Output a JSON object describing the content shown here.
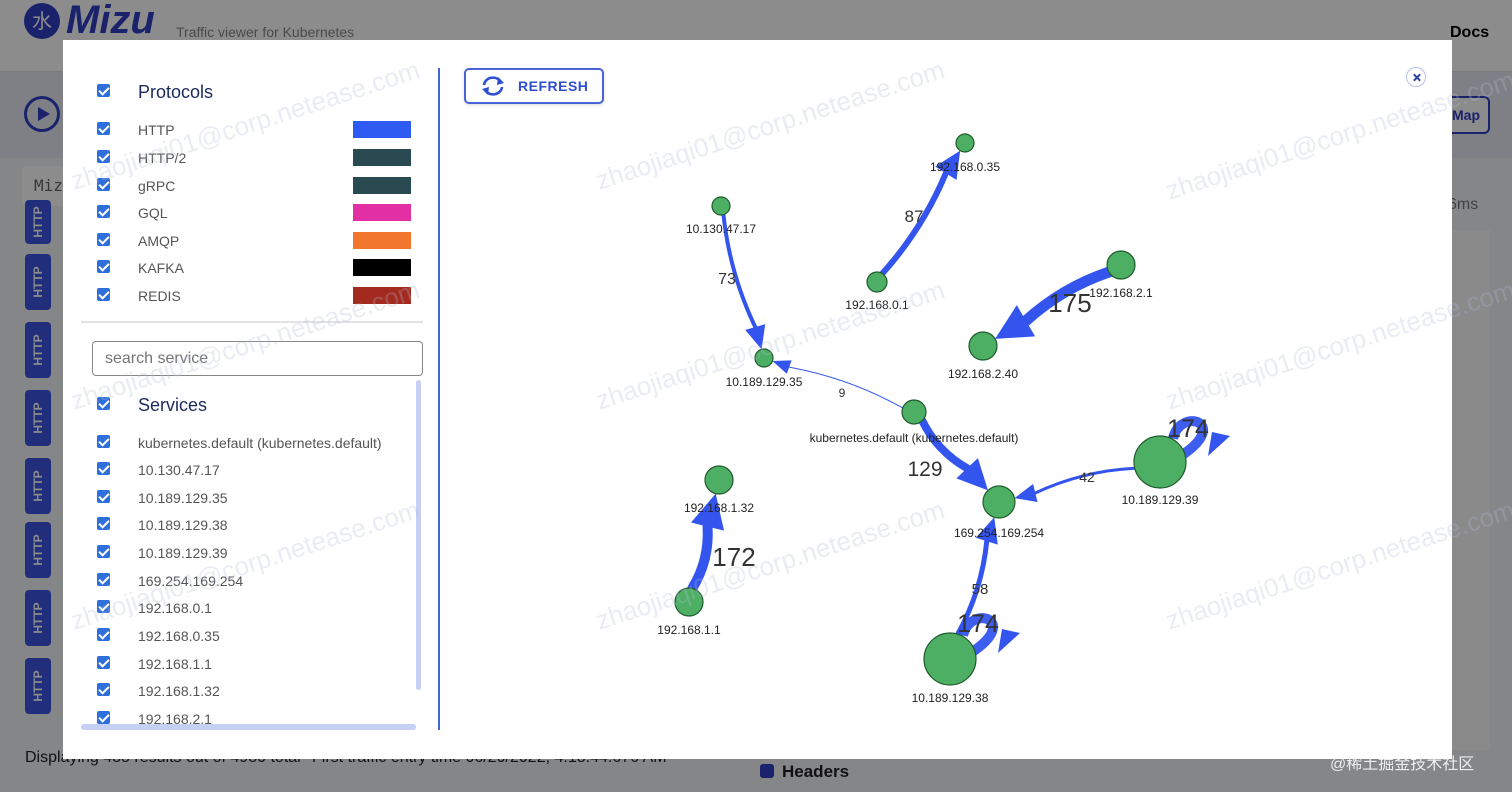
{
  "background": {
    "logo_glyph": "水",
    "logo_text": "Mizu",
    "tagline": "Traffic viewer for Kubernetes",
    "docs_link": "Docs",
    "map_button": "Map",
    "search_prefix": "Miz",
    "badge_label": "HTTP",
    "latency_fragment": "6ms",
    "footer_displaying": "Displaying 488 results out of 4980 total",
    "footer_first_entry": "First traffic entry time 06/20/2022, 4:18:44.676 AM",
    "headers_label": "Headers",
    "credit": "@稀土掘金技术社区"
  },
  "modal": {
    "refresh_label": "REFRESH",
    "protocols": {
      "title": "Protocols",
      "items": [
        {
          "label": "HTTP",
          "color": "#2e5cf2"
        },
        {
          "label": "HTTP/2",
          "color": "#2a4a52"
        },
        {
          "label": "gRPC",
          "color": "#2a4a52"
        },
        {
          "label": "GQL",
          "color": "#e22fa4"
        },
        {
          "label": "AMQP",
          "color": "#f2762e"
        },
        {
          "label": "KAFKA",
          "color": "#000000"
        },
        {
          "label": "REDIS",
          "color": "#a32a1e"
        }
      ]
    },
    "search_placeholder": "search service",
    "services": {
      "title": "Services",
      "items": [
        "kubernetes.default (kubernetes.default)",
        "10.130.47.17",
        "10.189.129.35",
        "10.189.129.38",
        "10.189.129.39",
        "169.254.169.254",
        "192.168.0.1",
        "192.168.0.35",
        "192.168.1.1",
        "192.168.1.32",
        "192.168.2.1"
      ]
    }
  },
  "graph": {
    "node_color": "#4caf63",
    "edge_color": "#3355ee",
    "nodes": [
      {
        "label": "192.168.0.35"
      },
      {
        "label": "10.130.47.17"
      },
      {
        "label": "192.168.0.1"
      },
      {
        "label": "192.168.2.1"
      },
      {
        "label": "192.168.2.40"
      },
      {
        "label": "10.189.129.35"
      },
      {
        "label": "kubernetes.default (kubernetes.default)"
      },
      {
        "label": "10.189.129.39"
      },
      {
        "label": "192.168.1.32"
      },
      {
        "label": "169.254.169.254"
      },
      {
        "label": "192.168.1.1"
      },
      {
        "label": "10.189.129.38"
      }
    ],
    "edges": [
      {
        "source": "192.168.0.1",
        "target": "192.168.0.35",
        "label": "87"
      },
      {
        "source": "10.130.47.17",
        "target": "10.189.129.35",
        "label": "73"
      },
      {
        "source": "192.168.2.1",
        "target": "192.168.2.40",
        "label": "175"
      },
      {
        "source": "kubernetes.default (kubernetes.default)",
        "target": "10.189.129.35",
        "label": "9"
      },
      {
        "source": "kubernetes.default (kubernetes.default)",
        "target": "169.254.169.254",
        "label": "129"
      },
      {
        "source": "10.189.129.39",
        "target": "169.254.169.254",
        "label": "42"
      },
      {
        "source": "10.189.129.39",
        "target": "10.189.129.39",
        "label": "174"
      },
      {
        "source": "192.168.1.1",
        "target": "192.168.1.32",
        "label": "172"
      },
      {
        "source": "10.189.129.38",
        "target": "169.254.169.254",
        "label": "58"
      },
      {
        "source": "10.189.129.38",
        "target": "10.189.129.38",
        "label": "174"
      }
    ]
  },
  "watermark_text": "zhaojiaqi01@corp.netease.com"
}
